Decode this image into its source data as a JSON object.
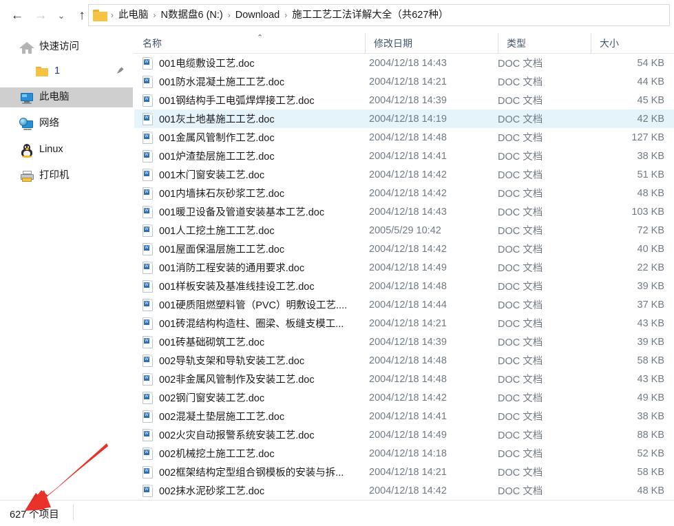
{
  "window": {
    "title": "施工工艺工法详解大全（共627种）"
  },
  "nav": {
    "back_icon": "arrow-left-icon",
    "back_label": "←",
    "forward_label": "→",
    "history_label": "⌄",
    "up_label": "↑"
  },
  "address": {
    "folder_icon": "folder-icon",
    "separator": "›",
    "crumbs": [
      "此电脑",
      "N数据盘6 (N:)",
      "Download",
      "施工工艺工法详解大全（共627种）"
    ]
  },
  "columns": {
    "name": "名称",
    "date": "修改日期",
    "type": "类型",
    "size": "大小",
    "sort_caret": "⌃"
  },
  "sidebar": {
    "items": [
      {
        "label": "快速访问",
        "icon": "home-icon",
        "indent": 0,
        "selected": false,
        "pinned": false
      },
      {
        "label": "1",
        "icon": "folder-icon",
        "indent": 1,
        "selected": false,
        "pinned": true,
        "pin_icon": "pin-icon",
        "pin_glyph": "📌"
      },
      {
        "label": "此电脑",
        "icon": "monitor-icon",
        "indent": 0,
        "selected": true,
        "pinned": false
      },
      {
        "label": "网络",
        "icon": "network-icon",
        "indent": 0,
        "selected": false,
        "pinned": false
      },
      {
        "label": "Linux",
        "icon": "penguin-icon",
        "indent": 0,
        "selected": false,
        "pinned": false
      },
      {
        "label": "打印机",
        "icon": "printer-icon",
        "indent": 0,
        "selected": false,
        "pinned": false
      }
    ]
  },
  "files": {
    "rows": [
      {
        "name": "001电缆敷设工艺.doc",
        "date": "2004/12/18 14:43",
        "type": "DOC 文档",
        "size": "54 KB",
        "hover": false
      },
      {
        "name": "001防水混凝土施工工艺.doc",
        "date": "2004/12/18 14:21",
        "type": "DOC 文档",
        "size": "44 KB",
        "hover": false
      },
      {
        "name": "001钢结构手工电弧焊焊接工艺.doc",
        "date": "2004/12/18 14:39",
        "type": "DOC 文档",
        "size": "45 KB",
        "hover": false
      },
      {
        "name": "001灰土地基施工工艺.doc",
        "date": "2004/12/18 14:19",
        "type": "DOC 文档",
        "size": "42 KB",
        "hover": true
      },
      {
        "name": "001金属风管制作工艺.doc",
        "date": "2004/12/18 14:48",
        "type": "DOC 文档",
        "size": "127 KB",
        "hover": false
      },
      {
        "name": "001炉渣垫层施工工艺.doc",
        "date": "2004/12/18 14:41",
        "type": "DOC 文档",
        "size": "38 KB",
        "hover": false
      },
      {
        "name": "001木门窗安装工艺.doc",
        "date": "2004/12/18 14:42",
        "type": "DOC 文档",
        "size": "51 KB",
        "hover": false
      },
      {
        "name": "001内墙抹石灰砂浆工艺.doc",
        "date": "2004/12/18 14:42",
        "type": "DOC 文档",
        "size": "48 KB",
        "hover": false
      },
      {
        "name": "001暖卫设备及管道安装基本工艺.doc",
        "date": "2004/12/18 14:43",
        "type": "DOC 文档",
        "size": "103 KB",
        "hover": false
      },
      {
        "name": "001人工挖土施工工艺.doc",
        "date": "2005/5/29 10:42",
        "type": "DOC 文档",
        "size": "72 KB",
        "hover": false
      },
      {
        "name": "001屋面保温层施工工艺.doc",
        "date": "2004/12/18 14:42",
        "type": "DOC 文档",
        "size": "40 KB",
        "hover": false
      },
      {
        "name": "001消防工程安装的通用要求.doc",
        "date": "2004/12/18 14:49",
        "type": "DOC 文档",
        "size": "22 KB",
        "hover": false
      },
      {
        "name": "001样板安装及基准线挂设工艺.doc",
        "date": "2004/12/18 14:48",
        "type": "DOC 文档",
        "size": "39 KB",
        "hover": false
      },
      {
        "name": "001硬质阻燃塑料管（PVC）明敷设工艺....",
        "date": "2004/12/18 14:44",
        "type": "DOC 文档",
        "size": "37 KB",
        "hover": false
      },
      {
        "name": "001砖混结构构造柱、圈梁、板缝支模工...",
        "date": "2004/12/18 14:21",
        "type": "DOC 文档",
        "size": "43 KB",
        "hover": false
      },
      {
        "name": "001砖基础砌筑工艺.doc",
        "date": "2004/12/18 14:39",
        "type": "DOC 文档",
        "size": "39 KB",
        "hover": false
      },
      {
        "name": "002导轨支架和导轨安装工艺.doc",
        "date": "2004/12/18 14:48",
        "type": "DOC 文档",
        "size": "58 KB",
        "hover": false
      },
      {
        "name": "002非金属风管制作及安装工艺.doc",
        "date": "2004/12/18 14:48",
        "type": "DOC 文档",
        "size": "43 KB",
        "hover": false
      },
      {
        "name": "002钢门窗安装工艺.doc",
        "date": "2004/12/18 14:42",
        "type": "DOC 文档",
        "size": "49 KB",
        "hover": false
      },
      {
        "name": "002混凝土垫层施工工艺.doc",
        "date": "2004/12/18 14:41",
        "type": "DOC 文档",
        "size": "38 KB",
        "hover": false
      },
      {
        "name": "002火灾自动报警系统安装工艺.doc",
        "date": "2004/12/18 14:49",
        "type": "DOC 文档",
        "size": "88 KB",
        "hover": false
      },
      {
        "name": "002机械挖土施工工艺.doc",
        "date": "2004/12/18 14:18",
        "type": "DOC 文档",
        "size": "52 KB",
        "hover": false
      },
      {
        "name": "002框架结构定型组合钢模板的安装与拆...",
        "date": "2004/12/18 14:21",
        "type": "DOC 文档",
        "size": "58 KB",
        "hover": false
      },
      {
        "name": "002抹水泥砂浆工艺.doc",
        "date": "2004/12/18 14:42",
        "type": "DOC 文档",
        "size": "48 KB",
        "hover": false
      }
    ]
  },
  "status": {
    "count_text": "627 个项目"
  },
  "annotation": {
    "arrow_color": "#e8322a",
    "arrow_icon": "red-arrow-annotation"
  }
}
